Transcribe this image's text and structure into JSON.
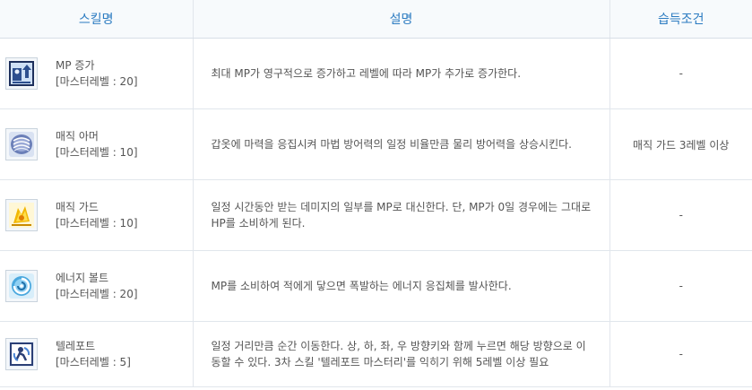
{
  "header": {
    "col_skill": "스킬명",
    "col_desc": "설명",
    "col_cond": "습득조건"
  },
  "rows": [
    {
      "icon": "mp-increase-icon",
      "name": "MP 증가",
      "master": "[마스터레벨 : 20]",
      "desc": "최대 MP가 영구적으로 증가하고 레벨에 따라 MP가 추가로 증가한다.",
      "cond": "-"
    },
    {
      "icon": "magic-armor-icon",
      "name": "매직 아머",
      "master": "[마스터레벨 : 10]",
      "desc": "갑옷에 마력을 응집시켜 마법 방어력의 일정 비율만큼 물리 방어력을 상승시킨다.",
      "cond": "매직 가드 3레벨 이상"
    },
    {
      "icon": "magic-guard-icon",
      "name": "매직 가드",
      "master": "[마스터레벨 : 10]",
      "desc": "일정 시간동안 받는 데미지의 일부를 MP로 대신한다. 단, MP가 0일 경우에는 그대로 HP를 소비하게 된다.",
      "cond": "-"
    },
    {
      "icon": "energy-bolt-icon",
      "name": "에너지 볼트",
      "master": "[마스터레벨 : 20]",
      "desc": "MP를 소비하여 적에게 닿으면 폭발하는 에너지 응집체를 발사한다.",
      "cond": "-"
    },
    {
      "icon": "teleport-icon",
      "name": "텔레포트",
      "master": "[마스터레벨 : 5]",
      "desc": "일정 거리만큼 순간 이동한다. 상, 하, 좌, 우 방향키와 함께 누르면 해당 방향으로 이동할 수 있다. 3차 스킬 '텔레포트 마스터리'를 익히기 위해 5레벨 이상 필요",
      "cond": "-"
    }
  ]
}
